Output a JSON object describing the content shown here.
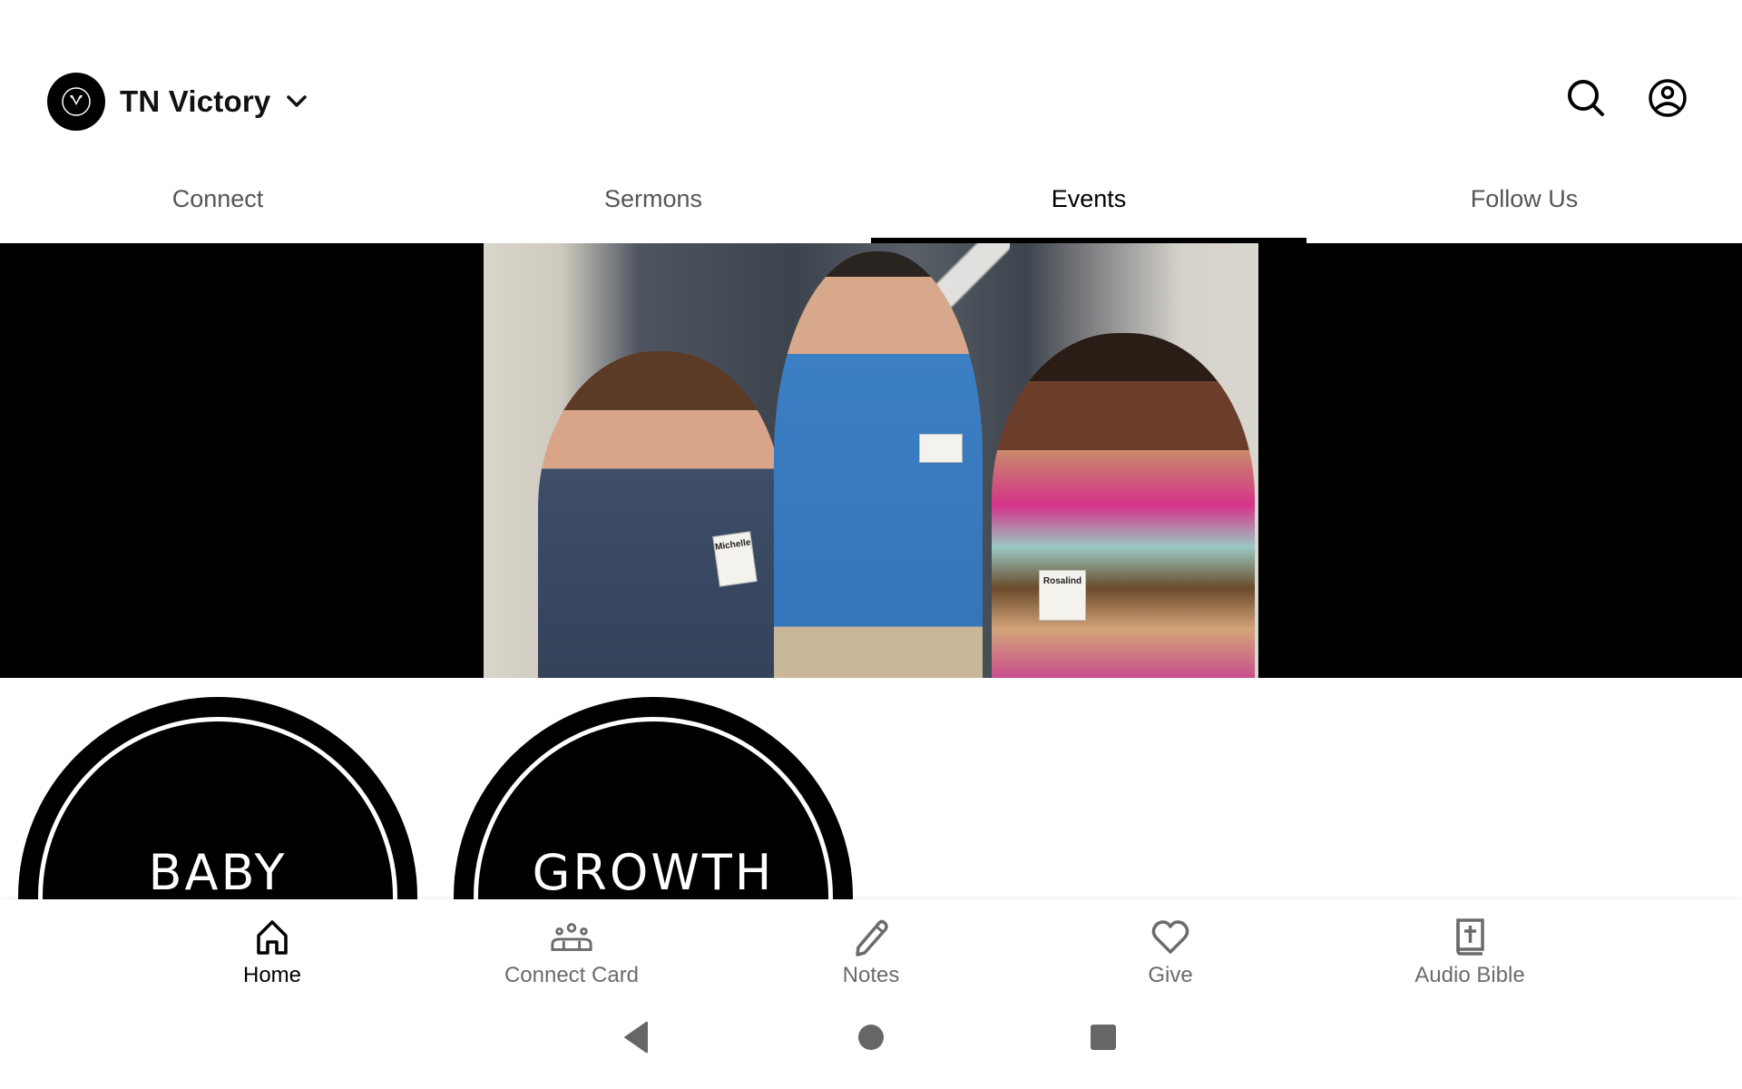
{
  "header": {
    "org_name": "TN Victory",
    "org_logo_icon": "victory-v-logo-icon",
    "chevron_icon": "chevron-down-icon",
    "search_icon": "search-icon",
    "profile_icon": "account-circle-icon"
  },
  "tabs": [
    {
      "label": "Connect",
      "active": false
    },
    {
      "label": "Sermons",
      "active": false
    },
    {
      "label": "Events",
      "active": true
    },
    {
      "label": "Follow Us",
      "active": false
    }
  ],
  "hero": {
    "badge_names": [
      "Michelle",
      "",
      "Rosalind"
    ]
  },
  "categories": [
    {
      "label": "BABY"
    },
    {
      "label": "GROWTH"
    }
  ],
  "bottom_nav": [
    {
      "label": "Home",
      "icon": "home-icon",
      "active": true
    },
    {
      "label": "Connect Card",
      "icon": "group-icon",
      "active": false
    },
    {
      "label": "Notes",
      "icon": "pencil-icon",
      "active": false
    },
    {
      "label": "Give",
      "icon": "heart-icon",
      "active": false
    },
    {
      "label": "Audio Bible",
      "icon": "bible-icon",
      "active": false
    }
  ],
  "system_nav": [
    "back",
    "home",
    "recents"
  ],
  "colors": {
    "active": "#000000",
    "inactive": "#6b6b6b",
    "tab_inactive": "#555555",
    "system_nav": "#666666"
  }
}
